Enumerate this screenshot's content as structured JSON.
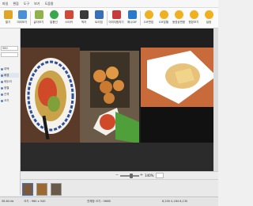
{
  "menu": [
    "파일",
    "편집",
    "도구",
    "보기",
    "도움말"
  ],
  "toolbar": {
    "buttons": [
      {
        "label": "열기",
        "icon": "open-folder-icon",
        "color": "#e0a526"
      },
      {
        "label": "미리보기",
        "icon": "preview-icon",
        "color": "#4a8fd8"
      },
      {
        "label": "글자보기",
        "icon": "text-view-icon",
        "color": "#8fb34a"
      },
      {
        "label": "말풍선",
        "icon": "speech-bubble-icon",
        "color": "#38a84a"
      },
      {
        "label": "스티커",
        "icon": "sticker-icon",
        "color": "#d04a3a"
      },
      {
        "label": "액자",
        "icon": "frame-icon",
        "color": "#3a3a3a"
      },
      {
        "label": "트리밍",
        "icon": "crop-icon",
        "color": "#3a6fb8"
      },
      {
        "label": "이미지합치기",
        "icon": "merge-images-icon",
        "color": "#c83a3a"
      },
      {
        "label": "애니GIF",
        "icon": "gif-icon",
        "color": "#2a7acc"
      },
      {
        "label": "GIF편집",
        "icon": "gif-edit-icon",
        "color": "#f0b020"
      },
      {
        "label": "GIF분할",
        "icon": "gif-split-icon",
        "color": "#f0b020"
      },
      {
        "label": "동영상변환",
        "icon": "video-convert-icon",
        "color": "#f0b020"
      },
      {
        "label": "원본보기",
        "icon": "original-view-icon",
        "color": "#f0b020"
      },
      {
        "label": "설정",
        "icon": "settings-icon",
        "color": "#f0b020"
      }
    ]
  },
  "left_panel": {
    "size_value": "960",
    "rows": [
      "여백",
      "배경",
      "테두리",
      "정렬",
      "간격",
      "크기"
    ]
  },
  "zoom": {
    "value": "140%"
  },
  "thumbnails": [
    {
      "icon": "photo-thumbnail-icon",
      "color": "#7a5a3a"
    },
    {
      "icon": "photo-thumbnail-icon",
      "color": "#9a6a30"
    },
    {
      "icon": "photo-thumbnail-icon",
      "color": "#6a5a4a"
    }
  ],
  "status": {
    "left": "58.64 kb",
    "size": "크기 : 960 x 540",
    "mid": "전체창 크기 : 56KB",
    "right": "8,200  0,184  8,130"
  }
}
